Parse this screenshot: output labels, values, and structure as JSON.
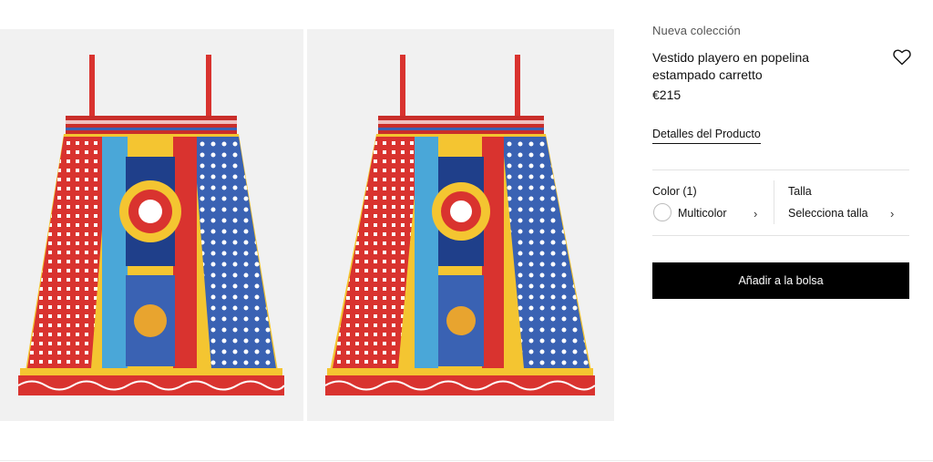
{
  "product": {
    "kicker": "Nueva colección",
    "title": "Vestido playero en popelina estampado carretto",
    "price": "€215",
    "details_link": "Detalles del Producto"
  },
  "options": {
    "color_label": "Color (1)",
    "color_value": "Multicolor",
    "size_label": "Talla",
    "size_value": "Selecciona talla",
    "chevron": "›"
  },
  "cta": {
    "add_to_bag": "Añadir a la bolsa"
  },
  "icons": {
    "wishlist": "heart-icon",
    "chevron": "chevron-right-icon"
  },
  "colors": {
    "button_bg": "#000000",
    "photo_bg": "#f1f1f1",
    "accent_red": "#d9332f",
    "accent_blue": "#3a62b3",
    "accent_yellow": "#f4c531"
  }
}
